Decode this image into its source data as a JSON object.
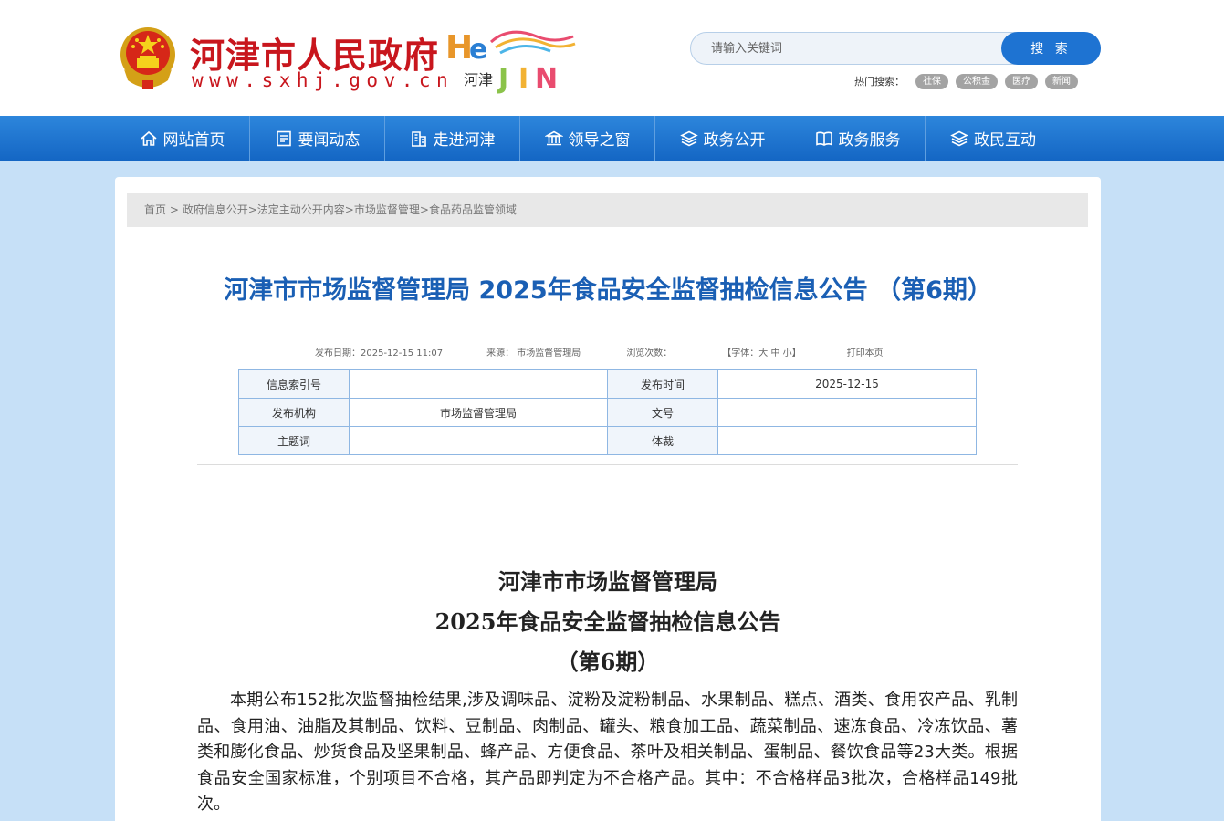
{
  "header": {
    "site_title": "河津市人民政府",
    "site_url": "www.sxhj.gov.cn",
    "logo_text_cn": "河津",
    "search": {
      "placeholder": "请输入关键词",
      "button": "搜 索"
    },
    "hot_search": {
      "label": "热门搜索：",
      "tags": [
        "社保",
        "公积金",
        "医疗",
        "新闻"
      ]
    }
  },
  "nav": {
    "items": [
      {
        "label": "网站首页",
        "icon": "home-icon"
      },
      {
        "label": "要闻动态",
        "icon": "news-icon"
      },
      {
        "label": "走进河津",
        "icon": "building-icon"
      },
      {
        "label": "领导之窗",
        "icon": "government-icon"
      },
      {
        "label": "政务公开",
        "icon": "layers-icon"
      },
      {
        "label": "政务服务",
        "icon": "book-icon"
      },
      {
        "label": "政民互动",
        "icon": "stack-icon"
      }
    ]
  },
  "breadcrumb": [
    "首页",
    " > ",
    "政府信息公开",
    ">",
    "法定主动公开内容",
    ">",
    "市场监督管理",
    ">",
    "食品药品监管领域"
  ],
  "article": {
    "title": "河津市市场监督管理局 2025年食品安全监督抽检信息公告 （第6期）",
    "meta": {
      "date": "发布日期：2025-12-15 11:07",
      "source": "来源： 市场监督管理局",
      "views": "浏览次数：",
      "font": "【字体：大 中 小】",
      "print": "打印本页"
    },
    "info_table": [
      [
        "信息索引号",
        "",
        "发布时间",
        "2025-12-15"
      ],
      [
        "发布机构",
        "市场监督管理局",
        "文号",
        ""
      ],
      [
        "主题词",
        "",
        "体裁",
        ""
      ]
    ],
    "body_title_lines": [
      "河津市市场监督管理局",
      "2025年食品安全监督抽检信息公告",
      "（第6期）"
    ],
    "body_paragraph": "本期公布152批次监督抽检结果,涉及调味品、淀粉及淀粉制品、水果制品、糕点、酒类、食用农产品、乳制品、食用油、油脂及其制品、饮料、豆制品、肉制品、罐头、粮食加工品、蔬菜制品、速冻食品、冷冻饮品、薯类和膨化食品、炒货食品及坚果制品、蜂产品、方便食品、茶叶及相关制品、蛋制品、餐饮食品等23大类。根据食品安全国家标准，个别项目不合格，其产品即判定为不合格产品。其中：不合格样品3批次，合格样品149批次。"
  },
  "colors": {
    "brand_red": "#c8161d",
    "nav_blue": "#1466c4",
    "title_blue": "#1a5fb4",
    "page_bg": "#c6e0f7"
  }
}
